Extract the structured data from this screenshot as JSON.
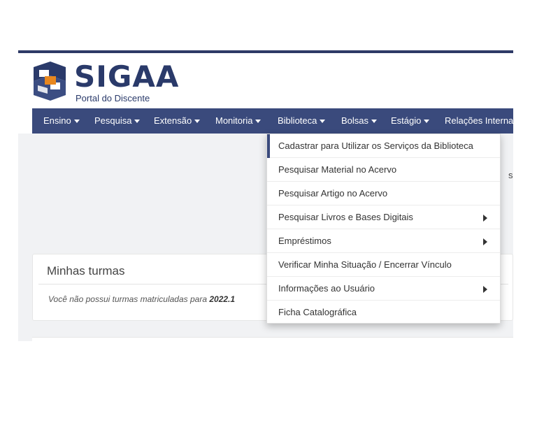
{
  "brand": {
    "name": "SIGAA",
    "subtitle": "Portal do Discente"
  },
  "nav": {
    "items": [
      {
        "label": "Ensino"
      },
      {
        "label": "Pesquisa"
      },
      {
        "label": "Extensão"
      },
      {
        "label": "Monitoria"
      },
      {
        "label": "Biblioteca"
      },
      {
        "label": "Bolsas"
      },
      {
        "label": "Estágio"
      },
      {
        "label": "Relações Interna"
      }
    ]
  },
  "biblioteca_menu": {
    "items": [
      {
        "label": "Cadastrar para Utilizar os Serviços da Biblioteca",
        "submenu": false
      },
      {
        "label": "Pesquisar Material no Acervo",
        "submenu": false
      },
      {
        "label": "Pesquisar Artigo no Acervo",
        "submenu": false
      },
      {
        "label": "Pesquisar Livros e Bases Digitais",
        "submenu": true
      },
      {
        "label": "Empréstimos",
        "submenu": true
      },
      {
        "label": "Verificar Minha Situação / Encerrar Vínculo",
        "submenu": false
      },
      {
        "label": "Informações ao Usuário",
        "submenu": true
      },
      {
        "label": "Ficha Catalográfica",
        "submenu": false
      }
    ]
  },
  "truncated_right_text": "s",
  "turmas": {
    "title": "Minhas turmas",
    "empty_message": "Você não possui turmas matriculadas para",
    "period": "2022.1"
  },
  "colors": {
    "navbar": "#3a4a7c",
    "brand": "#2a3a6a",
    "background": "#f1f2f4"
  }
}
